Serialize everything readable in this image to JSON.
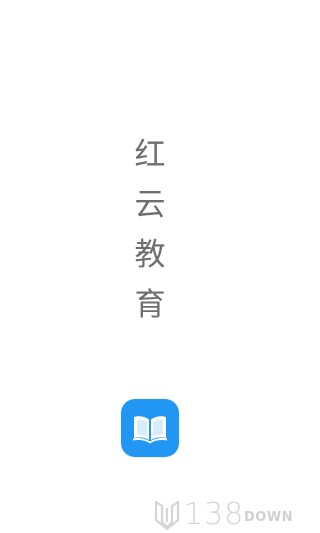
{
  "splash": {
    "title_chars": [
      "红",
      "云",
      "教",
      "育"
    ]
  },
  "app_icon": {
    "icon": "open-book-icon",
    "background_color": "#2196f3"
  },
  "watermark": {
    "number": "138",
    "word": "DOWN"
  }
}
